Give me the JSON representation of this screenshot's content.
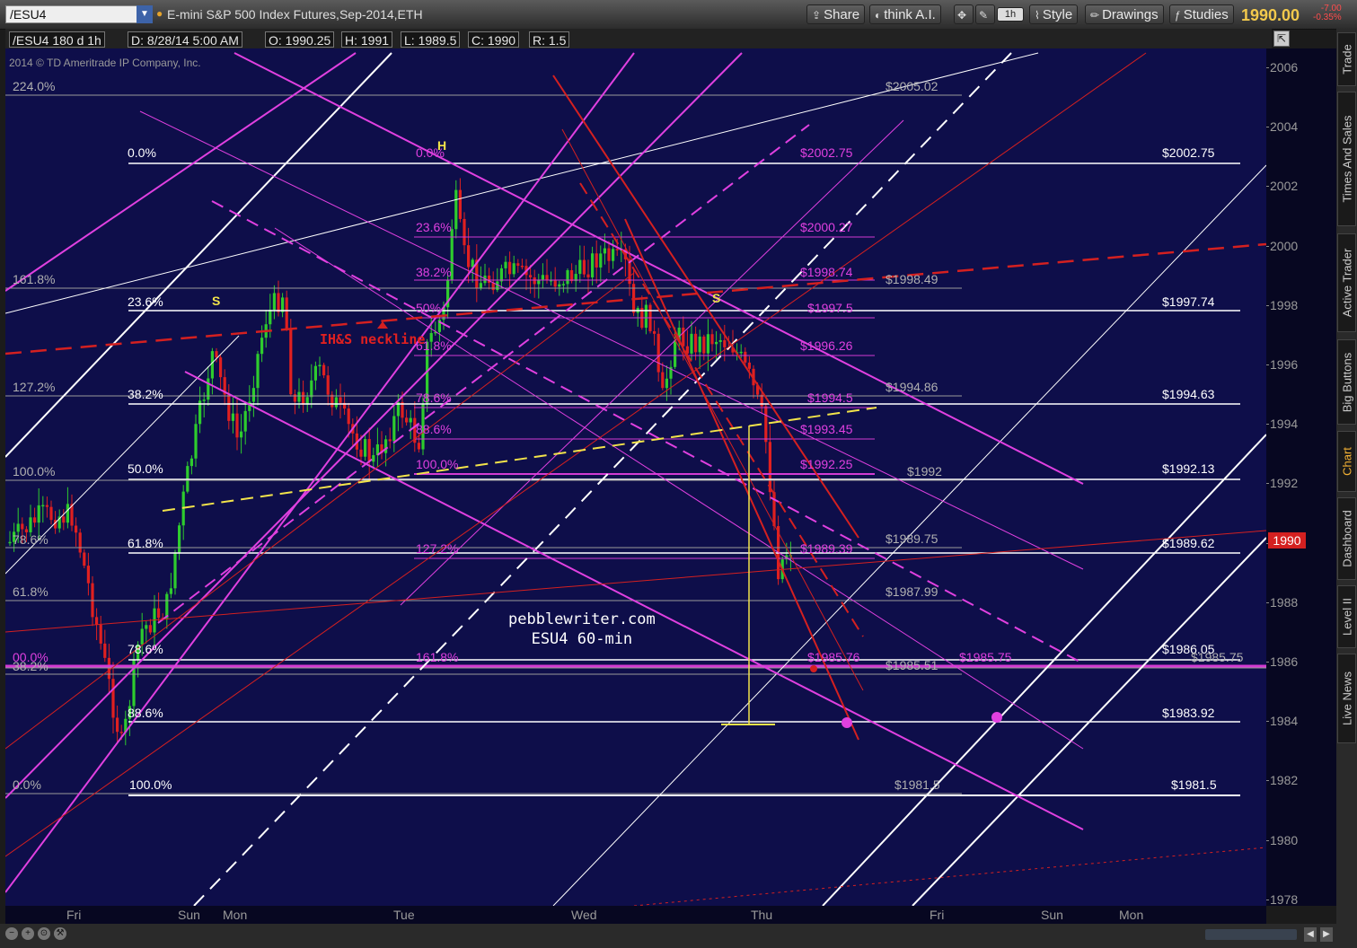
{
  "toolbar": {
    "symbol": "/ESU4",
    "description": "E-mini S&P 500 Index Futures,Sep-2014,ETH",
    "share": "Share",
    "think": "think A.I.",
    "timeframe": "1h",
    "style": "Style",
    "drawings": "Drawings",
    "studies": "Studies",
    "last_price": "1990.00",
    "net_change": "-7.00",
    "pct_change": "-0.35%"
  },
  "header": {
    "chart_id": "/ESU4 180 d 1h",
    "date": "D: 8/28/14 5:00 AM",
    "open": "O: 1990.25",
    "high": "H: 1991",
    "low": "L: 1989.5",
    "close": "C: 1990",
    "range": "R: 1.5"
  },
  "copyright": "2014 © TD Ameritrade IP Company, Inc.",
  "watermark": {
    "line1": "pebblewriter.com",
    "line2": "ESU4 60-min"
  },
  "price_tag": "1990",
  "y_ticks": [
    "2006",
    "2004",
    "2002",
    "2000",
    "1998",
    "1996",
    "1994",
    "1992",
    "1990",
    "1988",
    "1986",
    "1984",
    "1982",
    "1980",
    "1978"
  ],
  "x_ticks": [
    "Fri",
    "Sun",
    "Mon",
    "Tue",
    "Wed",
    "Thu",
    "Fri",
    "Sun",
    "Mon"
  ],
  "side_tabs": [
    "Trade",
    "Times And Sales",
    "Active Trader",
    "Big Buttons",
    "Chart",
    "Dashboard",
    "Level II",
    "Live News"
  ],
  "labels": {
    "white": [
      "$2002.75",
      "0.0%",
      "23.6%",
      "38.2%",
      "50.0%",
      "61.8%",
      "78.6%",
      "88.6%",
      "100.0%",
      "$1997.74",
      "$1994.63",
      "$1992.13",
      "$1989.62",
      "$1986.05",
      "$1983.92",
      "$1981.5"
    ],
    "grey": [
      "224.0%",
      "161.8%",
      "127.2%",
      "100.0%",
      "61.8%",
      "38.2%",
      "0.0%",
      "78.6%",
      "$2005.02",
      "$1998.49",
      "$1994.86",
      "$1992",
      "$1989.75",
      "$1987.99",
      "$1985.51",
      "$1981.5",
      "$1985.75"
    ],
    "magenta": [
      "0.0%",
      "23.6%",
      "38.2%",
      "50%",
      "61.8%",
      "78.6%",
      "88.6%",
      "100.0%",
      "127.2%",
      "161.8%",
      "$2002.75",
      "$2000.27",
      "$1998.74",
      "$1997.5",
      "$1996.26",
      "$1994.5",
      "$1993.45",
      "$1992.25",
      "$1989.39",
      "$1985.76",
      "$1985.75",
      "00.0%"
    ],
    "red": [
      "IH&S neckline"
    ],
    "pattern": [
      "S",
      "H",
      "S"
    ]
  },
  "colors": {
    "background": "#0e0e4a",
    "up_candle": "#2ecc2e",
    "down_candle": "#e02020",
    "magenta": "#e040e0",
    "yellow": "#f2e34a",
    "red": "#d42020",
    "accent": "#f2c94c"
  }
}
